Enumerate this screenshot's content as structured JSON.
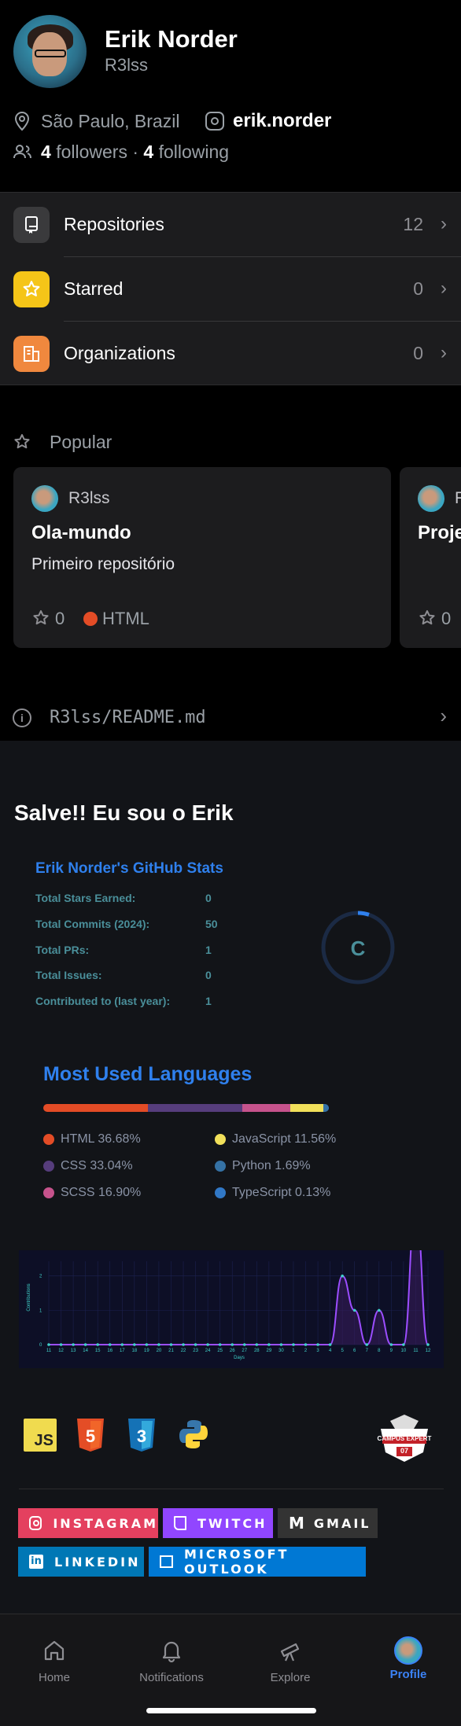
{
  "profile": {
    "name": "Erik Norder",
    "username": "R3lss",
    "location": "São Paulo, Brazil",
    "instagram": "erik.norder",
    "followers_count": "4",
    "followers_label": "followers",
    "separator": "·",
    "following_count": "4",
    "following_label": "following"
  },
  "menu": [
    {
      "label": "Repositories",
      "count": "12",
      "color": "#3a3a3c"
    },
    {
      "label": "Starred",
      "count": "0",
      "color": "#f5c518"
    },
    {
      "label": "Organizations",
      "count": "0",
      "color": "#f0883e"
    }
  ],
  "popular": {
    "title": "Popular",
    "cards": [
      {
        "owner": "R3lss",
        "name": "Ola-mundo",
        "description": "Primeiro repositório",
        "stars": "0",
        "language": "HTML",
        "language_color": "#e34c26"
      },
      {
        "owner": "R",
        "name": "Proje",
        "stars": "0"
      }
    ]
  },
  "readme": {
    "path": "R3lss/README.md",
    "heading": "Salve!! Eu sou o Erik",
    "stats": {
      "title": "Erik Norder's GitHub Stats",
      "rows": [
        {
          "label": "Total Stars Earned:",
          "value": "0"
        },
        {
          "label": "Total Commits (2024):",
          "value": "50"
        },
        {
          "label": "Total PRs:",
          "value": "1"
        },
        {
          "label": "Total Issues:",
          "value": "0"
        },
        {
          "label": "Contributed to (last year):",
          "value": "1"
        }
      ],
      "grade": "C"
    },
    "languages": {
      "title": "Most Used Languages",
      "items": [
        {
          "label": "HTML 36.68%",
          "pct": 36.68,
          "color": "#e34c26"
        },
        {
          "label": "CSS 33.04%",
          "pct": 33.04,
          "color": "#563d7c"
        },
        {
          "label": "SCSS 16.90%",
          "pct": 16.9,
          "color": "#c6538c"
        },
        {
          "label": "JavaScript 11.56%",
          "pct": 11.56,
          "color": "#f1e05a"
        },
        {
          "label": "Python 1.69%",
          "pct": 1.69,
          "color": "#3572a5"
        },
        {
          "label": "TypeScript 0.13%",
          "pct": 0.13,
          "color": "#3178c6"
        }
      ]
    },
    "contrib_chart": {
      "type": "area",
      "ylabel": "Contributions",
      "xlabel": "Days",
      "x": [
        "11",
        "12",
        "13",
        "14",
        "15",
        "16",
        "17",
        "18",
        "19",
        "20",
        "21",
        "22",
        "23",
        "24",
        "25",
        "26",
        "27",
        "28",
        "29",
        "30",
        "1",
        "2",
        "3",
        "4",
        "5",
        "6",
        "7",
        "8",
        "9",
        "10",
        "11",
        "12"
      ],
      "values": [
        0,
        0,
        0,
        0,
        0,
        0,
        0,
        0,
        0,
        0,
        0,
        0,
        0,
        0,
        0,
        0,
        0,
        0,
        0,
        0,
        0,
        0,
        0,
        0,
        2,
        1,
        0,
        1,
        0,
        0,
        4,
        0
      ],
      "yticks": [
        "0",
        "1",
        "2"
      ],
      "ylim": [
        0,
        2.2
      ]
    },
    "tech_icons": [
      "js-icon",
      "html5-icon",
      "css3-icon",
      "python-icon"
    ],
    "campus_badge": "CAMPUS EXPERT",
    "campus_badge_num": "07",
    "social_badges": [
      {
        "label": "INSTAGRAM",
        "color": "#e4405f"
      },
      {
        "label": "TWITCH",
        "color": "#9146ff"
      },
      {
        "label": "GMAIL",
        "color": "#333333"
      },
      {
        "label": "LINKEDIN",
        "color": "#0077b5"
      },
      {
        "label": "MICROSOFT OUTLOOK",
        "color": "#0078d4"
      }
    ]
  },
  "tabs": [
    {
      "label": "Home"
    },
    {
      "label": "Notifications"
    },
    {
      "label": "Explore"
    },
    {
      "label": "Profile"
    }
  ],
  "colors": {
    "accent": "#3b82f6",
    "stats_title": "#2f80ed"
  }
}
